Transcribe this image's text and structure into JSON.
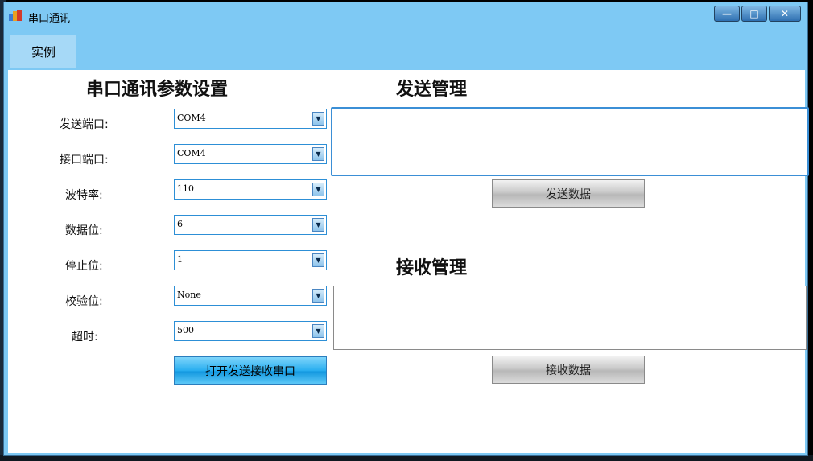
{
  "window": {
    "title": "串口通讯",
    "controls": {
      "minimize": "—",
      "maximize": "□",
      "close": "✕"
    }
  },
  "menu": {
    "items": [
      {
        "label": "实例"
      }
    ]
  },
  "settings": {
    "heading": "串口通讯参数设置",
    "fields": [
      {
        "label": "发送端口:",
        "value": "COM4"
      },
      {
        "label": "接口端口:",
        "value": "COM4"
      },
      {
        "label": "波特率:",
        "value": "110"
      },
      {
        "label": "数据位:",
        "value": "6"
      },
      {
        "label": "停止位:",
        "value": "1"
      },
      {
        "label": "校验位:",
        "value": "None"
      },
      {
        "label": "超时:",
        "value": "500"
      }
    ],
    "open_button": "打开发送接收串口"
  },
  "send": {
    "heading": "发送管理",
    "text": "",
    "button": "发送数据"
  },
  "receive": {
    "heading": "接收管理",
    "text": "",
    "button": "接收数据"
  },
  "colors": {
    "frame": "#7ec9f4",
    "accent_border": "#2d8fd6",
    "button_blue": "#29aef0",
    "button_gray": "#c9c9c9"
  },
  "icons": {
    "app": "app-window-icon",
    "dropdown": "chevron-down-icon"
  }
}
